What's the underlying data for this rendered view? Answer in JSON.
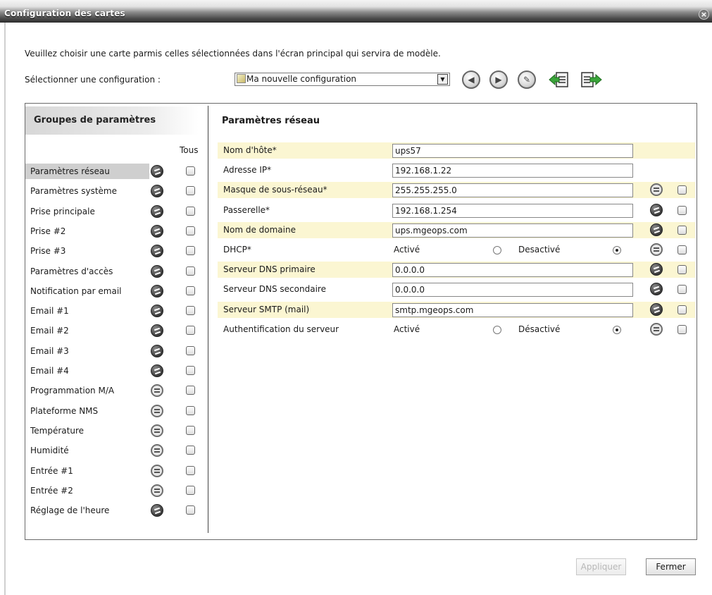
{
  "window": {
    "title": "Configuration des cartes",
    "close_glyph": "×"
  },
  "intro": "Veuillez choisir une carte parmis celles sélectionnées dans l'écran principal qui servira de modèle.",
  "selector": {
    "label": "Sélectionner une configuration :",
    "value": "Ma nouvelle configuration",
    "dropdown_glyph": "▼"
  },
  "toolbar": {
    "prev_glyph": "◀",
    "next_glyph": "▶",
    "edit_glyph": "✎",
    "icons": [
      "previous-icon",
      "next-icon",
      "edit-icon",
      "import-icon",
      "export-icon"
    ]
  },
  "groups": {
    "header": "Groupes de paramètres",
    "tous_label": "Tous",
    "items": [
      {
        "label": "Paramètres réseau",
        "state": "modified",
        "active": true
      },
      {
        "label": "Paramètres système",
        "state": "modified"
      },
      {
        "label": "Prise principale",
        "state": "modified"
      },
      {
        "label": "Prise #2",
        "state": "modified"
      },
      {
        "label": "Prise #3",
        "state": "modified"
      },
      {
        "label": "Paramètres d'accès",
        "state": "modified"
      },
      {
        "label": "Notification par email",
        "state": "modified"
      },
      {
        "label": "Email #1",
        "state": "modified"
      },
      {
        "label": "Email #2",
        "state": "modified"
      },
      {
        "label": "Email #3",
        "state": "modified"
      },
      {
        "label": "Email #4",
        "state": "modified"
      },
      {
        "label": "Programmation M/A",
        "state": "equal"
      },
      {
        "label": "Plateforme NMS",
        "state": "equal"
      },
      {
        "label": "Température",
        "state": "equal"
      },
      {
        "label": "Humidité",
        "state": "equal"
      },
      {
        "label": "Entrée #1",
        "state": "equal"
      },
      {
        "label": "Entrée #2",
        "state": "equal"
      },
      {
        "label": "Réglage de l'heure",
        "state": "modified"
      }
    ]
  },
  "params": {
    "title": "Paramètres réseau",
    "rows": [
      {
        "label": "Nom d'hôte*",
        "type": "text",
        "value": "ups57",
        "status": null
      },
      {
        "label": "Adresse IP*",
        "type": "text",
        "value": "192.168.1.22",
        "status": null
      },
      {
        "label": "Masque de sous-réseau*",
        "type": "text",
        "value": "255.255.255.0",
        "status": "equal"
      },
      {
        "label": "Passerelle*",
        "type": "text",
        "value": "192.168.1.254",
        "status": "modified"
      },
      {
        "label": "Nom de domaine",
        "type": "text",
        "value": "ups.mgeops.com",
        "status": "modified"
      },
      {
        "label": "DHCP*",
        "type": "radio",
        "opt1": "Activé",
        "opt2": "Desactivé",
        "selected": 2,
        "status": "equal"
      },
      {
        "label": "Serveur DNS primaire",
        "type": "text",
        "value": "0.0.0.0",
        "status": "modified"
      },
      {
        "label": "Serveur DNS secondaire",
        "type": "text",
        "value": "0.0.0.0",
        "status": "modified"
      },
      {
        "label": "Serveur SMTP (mail)",
        "type": "text",
        "value": "smtp.mgeops.com",
        "status": "modified"
      },
      {
        "label": "Authentification du serveur",
        "type": "radio",
        "opt1": "Activé",
        "opt2": "Désactivé",
        "selected": 2,
        "status": "equal"
      }
    ]
  },
  "buttons": {
    "apply": "Appliquer",
    "close": "Fermer"
  }
}
